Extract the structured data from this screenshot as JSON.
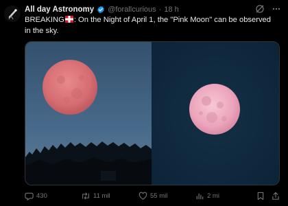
{
  "tweet": {
    "author_name": "All day Astronomy",
    "handle": "@forallcurious",
    "separator": "·",
    "time": "18 h",
    "text_prefix": "BREAKING",
    "text_body": ": On the Night of April 1, the \"Pink Moon\" can be observed in the sky."
  },
  "stats": {
    "replies": "430",
    "reposts": "11 mil",
    "likes": "55 mil",
    "views": "2 mi"
  },
  "icons": {
    "avatar": "telescope-icon",
    "verified": "verified-badge-icon",
    "grok": "grok-icon",
    "more": "more-icon",
    "flag": "flag-icon",
    "reply": "reply-icon",
    "repost": "repost-icon",
    "like": "heart-icon",
    "views": "views-icon",
    "bookmark": "bookmark-icon",
    "share": "share-icon"
  },
  "colors": {
    "accent_blue": "#1d9bf0",
    "muted_text": "#71767b",
    "text": "#e7e9ea"
  }
}
